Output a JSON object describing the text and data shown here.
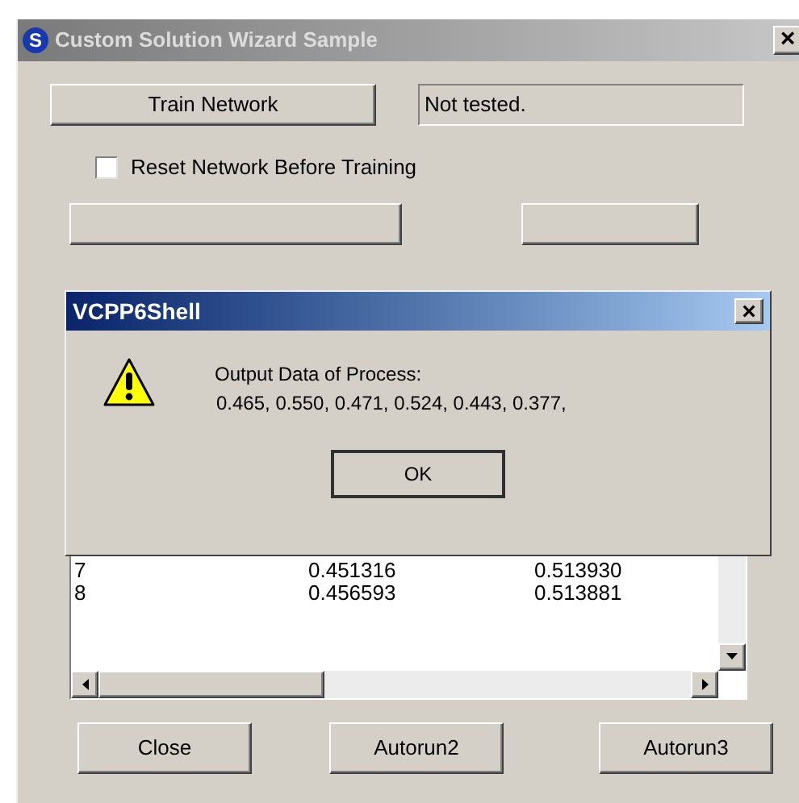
{
  "window": {
    "icon_letter": "S",
    "title": "Custom Solution Wizard Sample",
    "close": "×"
  },
  "train_button": "Train Network",
  "status_field": "Not tested.",
  "reset_checkbox": {
    "label": "Reset Network Before Training",
    "checked": false
  },
  "list": {
    "rows": [
      {
        "column_1": "7",
        "column_2": "0.451316",
        "column_3": "0.513930"
      },
      {
        "column_1": "8",
        "column_2": "0.456593",
        "column_3": "0.513881"
      }
    ]
  },
  "buttons": [
    "Close",
    "Autorun2",
    "Autorun3"
  ],
  "message_box": {
    "title": "VCPP6Shell",
    "close": "×",
    "heading": "Output Data of Process:",
    "values": "0.465, 0.550, 0.471, 0.524, 0.443, 0.377,",
    "ok": "OK"
  }
}
